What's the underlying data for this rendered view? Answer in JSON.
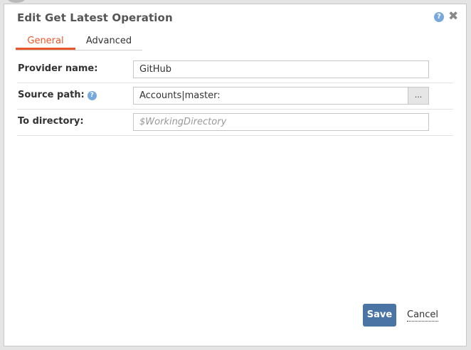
{
  "dialog": {
    "title": "Edit Get Latest Operation",
    "help_icon": "?",
    "close_icon": "✖"
  },
  "tabs": [
    {
      "label": "General",
      "active": true
    },
    {
      "label": "Advanced",
      "active": false
    }
  ],
  "form": {
    "provider_name": {
      "label": "Provider name:",
      "value": "GitHub"
    },
    "source_path": {
      "label": "Source path:",
      "help": "?",
      "value": "Accounts|master:",
      "browse_label": "..."
    },
    "to_directory": {
      "label": "To directory:",
      "value": "",
      "placeholder": "$WorkingDirectory"
    }
  },
  "footer": {
    "save_label": "Save",
    "cancel_label": "Cancel"
  },
  "colors": {
    "accent": "#e8582c",
    "primary_button": "#4a74a4",
    "help_icon": "#79a9dc"
  }
}
